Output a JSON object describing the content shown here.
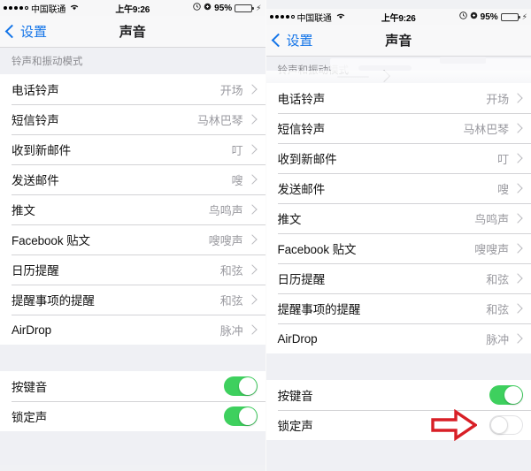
{
  "status_bar": {
    "signal_dots_filled": 4,
    "signal_dots_total": 5,
    "carrier": "中国联通",
    "wifi_icon": "wifi-icon",
    "time": "上午9:26",
    "alarm_icon": "alarm-clock-icon",
    "rotation_lock_icon": "rotation-lock-icon",
    "battery_percent": "95%",
    "battery_charging_icon": "lightning-bolt-icon",
    "battery_color": "#3ad159"
  },
  "navbar": {
    "back_icon": "chevron-left-icon",
    "back_label": "设置",
    "title": "声音",
    "tint_color": "#1374e8"
  },
  "section_header": "铃声和振动模式",
  "sound_rows": [
    {
      "label": "电话铃声",
      "value": "开场"
    },
    {
      "label": "短信铃声",
      "value": "马林巴琴"
    },
    {
      "label": "收到新邮件",
      "value": "叮"
    },
    {
      "label": "发送邮件",
      "value": "嗖"
    },
    {
      "label": "推文",
      "value": "鸟鸣声"
    },
    {
      "label": "Facebook 贴文",
      "value": "嗖嗖声"
    },
    {
      "label": "日历提醒",
      "value": "和弦"
    },
    {
      "label": "提醒事项的提醒",
      "value": "和弦"
    },
    {
      "label": "AirDrop",
      "value": "脉冲"
    }
  ],
  "toggle_rows_left": [
    {
      "label": "按键音",
      "state": "on"
    },
    {
      "label": "锁定声",
      "state": "on"
    }
  ],
  "toggle_rows_right": [
    {
      "label": "按键音",
      "state": "on"
    },
    {
      "label": "锁定声",
      "state": "off"
    }
  ],
  "annotation": {
    "arrow_icon": "red-arrow-right-icon",
    "arrow_color": "#d81f26",
    "points_at": "锁定声"
  },
  "colors": {
    "switch_on": "#3ed05e",
    "switch_off_track": "#ffffff",
    "background_gray": "#eff0f4",
    "row_background": "#ffffff",
    "value_text": "#9a9aa0"
  }
}
